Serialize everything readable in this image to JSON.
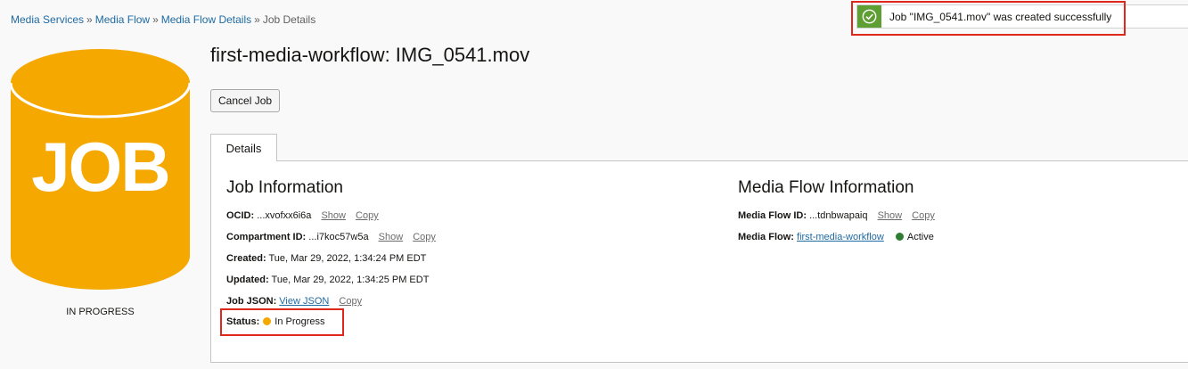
{
  "breadcrumb": {
    "items": [
      "Media Services",
      "Media Flow",
      "Media Flow Details"
    ],
    "current": "Job Details",
    "separator": "»"
  },
  "toast": {
    "message": "Job \"IMG_0541.mov\" was created successfully",
    "icon": "check-circle-icon",
    "color": "#5e9e33"
  },
  "job_icon": {
    "label": "JOB",
    "state": "IN PROGRESS",
    "color": "#f5a800"
  },
  "title": "first-media-workflow: IMG_0541.mov",
  "cancel_button": "Cancel Job",
  "tabs": [
    "Details"
  ],
  "job_info": {
    "title": "Job Information",
    "ocid_label": "OCID:",
    "ocid_value": "...xvofxx6i6a",
    "compartment_label": "Compartment ID:",
    "compartment_value": "...i7koc57w5a",
    "created_label": "Created:",
    "created_value": "Tue, Mar 29, 2022, 1:34:24 PM EDT",
    "updated_label": "Updated:",
    "updated_value": "Tue, Mar 29, 2022, 1:34:25 PM EDT",
    "json_label": "Job JSON:",
    "json_link": "View JSON",
    "status_label": "Status:",
    "status_value": "In Progress",
    "status_color": "#f5a800"
  },
  "media_flow_info": {
    "title": "Media Flow Information",
    "id_label": "Media Flow ID:",
    "id_value": "...tdnbwapaiq",
    "flow_label": "Media Flow:",
    "flow_link": "first-media-workflow",
    "flow_state": "Active",
    "flow_state_color": "#2e7d32"
  },
  "actions": {
    "show": "Show",
    "copy": "Copy"
  }
}
